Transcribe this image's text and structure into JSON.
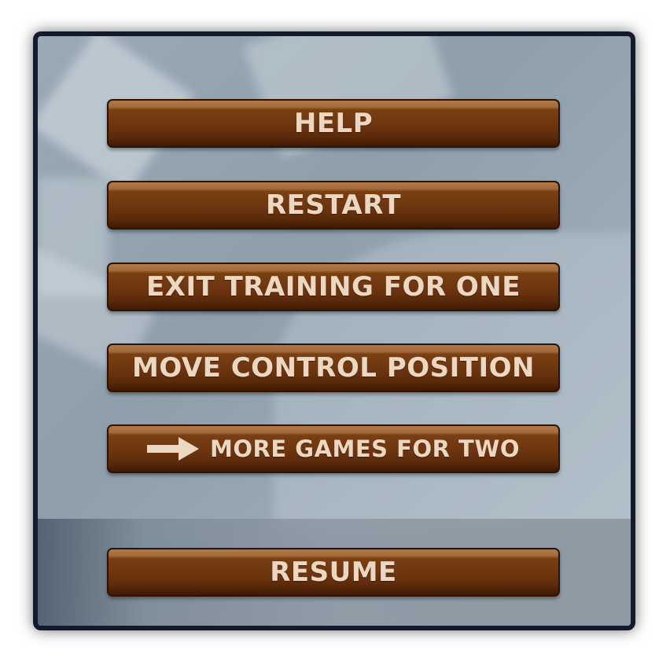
{
  "menu": {
    "buttons": {
      "help": "HELP",
      "restart": "RESTART",
      "exit_training": "EXIT TRAINING FOR ONE",
      "move_control": "MOVE CONTROL POSITION",
      "more_games": "MORE GAMES FOR TWO",
      "resume": "RESUME"
    },
    "more_games_icon": "arrow-right-icon"
  },
  "colors": {
    "button_brown": "#6d3510",
    "button_text": "#ecd8c2",
    "panel_border": "#121a2e",
    "panel_background": "#9aa9b5"
  }
}
